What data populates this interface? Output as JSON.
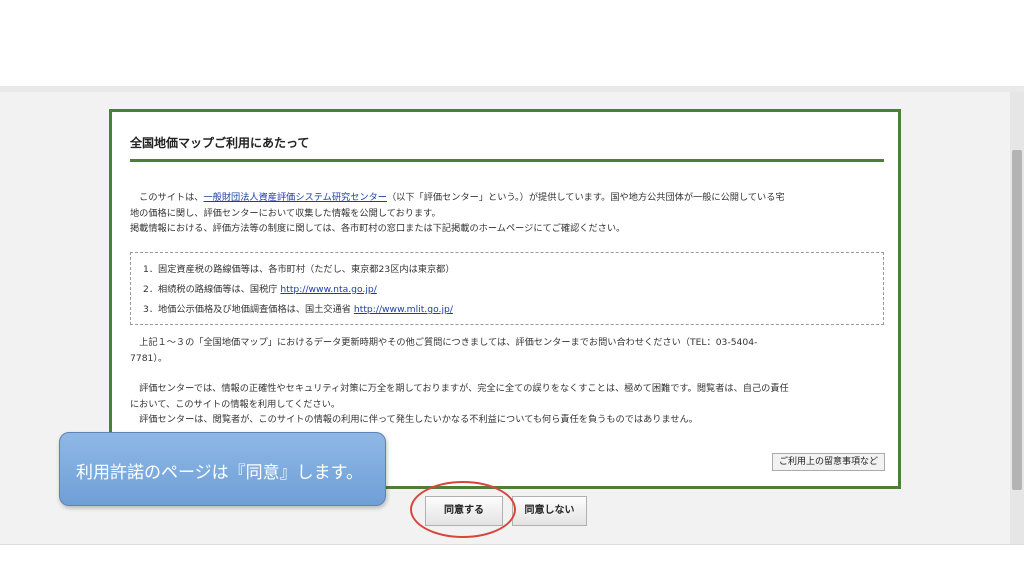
{
  "dialog": {
    "title": "全国地価マップご利用にあたって",
    "intro": {
      "line1_pre": "　このサイトは、",
      "link_center": "一般財団法人資産評価システム研究センター",
      "line1_post": "（以下「評価センター」という。）が提供しています。国や地方公共団体が一般に公開している宅",
      "line2": "地の価格に関し、評価センターにおいて収集した情報を公開しております。",
      "line3": "掲載情報における、評価方法等の制度に関しては、各市町村の窓口または下記掲載のホームページにてご確認ください。"
    },
    "list": {
      "item1": "1．固定資産税の路線価等は、各市町村（ただし、東京都23区内は東京都）",
      "item2_pre": "2．相続税の路線価等は、国税庁 ",
      "item2_link": "http://www.nta.go.jp/",
      "item3_pre": "3．地価公示価格及び地価調査価格は、国土交通省 ",
      "item3_link": "http://www.mlit.go.jp/"
    },
    "contact": {
      "line1": "　上記１～３の「全国地価マップ」におけるデータ更新時期やその他ご質問につきましては、評価センターまでお問い合わせください（TEL：03-5404-",
      "line2": "7781）。"
    },
    "disclaimer": {
      "line1": "　評価センターでは、情報の正確性やセキュリティ対策に万全を期しておりますが、完全に全ての誤りをなくすことは、極めて困難です。閲覧者は、自己の責任",
      "line2": "において、このサイトの情報を利用してください。",
      "line3": "　評価センターは、閲覧者が、このサイトの情報の利用に伴って発生したいかなる不利益についても何ら責任を負うものではありません。"
    },
    "notes_button": "ご利用上の留意事項など"
  },
  "buttons": {
    "agree": "同意する",
    "disagree": "同意しない"
  },
  "callout": {
    "text": "利用許諾のページは『同意』します。"
  },
  "colors": {
    "frame_green": "#4e7f39",
    "link_blue": "#1a3ea5",
    "highlight_red": "#d6473a",
    "callout_blue": "#7eacdf"
  }
}
